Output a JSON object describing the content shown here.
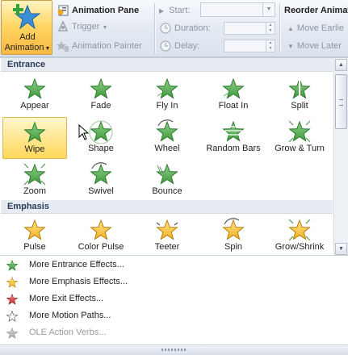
{
  "ribbon": {
    "add_animation": {
      "line1": "Add",
      "line2": "Animation"
    },
    "animation_pane": "Animation Pane",
    "trigger": "Trigger",
    "animation_painter": "Animation Painter",
    "start_label": "Start:",
    "duration_label": "Duration:",
    "delay_label": "Delay:",
    "reorder_label": "Reorder Animati",
    "move_earlier": "Move Earlie",
    "move_later": "Move Later"
  },
  "gallery": {
    "entrance_header": "Entrance",
    "emphasis_header": "Emphasis",
    "entrance": [
      {
        "label": "Appear",
        "icon": "star-appear-icon"
      },
      {
        "label": "Fade",
        "icon": "star-fade-icon"
      },
      {
        "label": "Fly In",
        "icon": "star-fly-in-icon"
      },
      {
        "label": "Float In",
        "icon": "star-float-in-icon"
      },
      {
        "label": "Split",
        "icon": "star-split-icon"
      },
      {
        "label": "Wipe",
        "icon": "star-wipe-icon",
        "selected": true
      },
      {
        "label": "Shape",
        "icon": "star-shape-icon"
      },
      {
        "label": "Wheel",
        "icon": "star-wheel-icon"
      },
      {
        "label": "Random Bars",
        "icon": "star-random-bars-icon"
      },
      {
        "label": "Grow & Turn",
        "icon": "star-grow-turn-icon"
      },
      {
        "label": "Zoom",
        "icon": "star-zoom-icon"
      },
      {
        "label": "Swivel",
        "icon": "star-swivel-icon"
      },
      {
        "label": "Bounce",
        "icon": "star-bounce-icon"
      }
    ],
    "emphasis": [
      {
        "label": "Pulse",
        "icon": "star-pulse-icon"
      },
      {
        "label": "Color Pulse",
        "icon": "star-color-pulse-icon"
      },
      {
        "label": "Teeter",
        "icon": "star-teeter-icon"
      },
      {
        "label": "Spin",
        "icon": "star-spin-icon"
      },
      {
        "label": "Grow/Shrink",
        "icon": "star-grow-shrink-icon"
      }
    ]
  },
  "menu": [
    {
      "label": "More Entrance Effects...",
      "icon": "green-star-icon"
    },
    {
      "label": "More Emphasis Effects...",
      "icon": "yellow-star-icon"
    },
    {
      "label": "More Exit Effects...",
      "icon": "red-star-icon"
    },
    {
      "label": "More Motion Paths...",
      "icon": "outline-star-icon"
    },
    {
      "label": "OLE Action Verbs...",
      "icon": "gray-star-icon",
      "disabled": true
    }
  ],
  "colors": {
    "entrance_green": "#3f9a3c",
    "emphasis_gold": "#f2b01e",
    "selection": "#ffe487",
    "section_header_text": "#283c5a"
  }
}
